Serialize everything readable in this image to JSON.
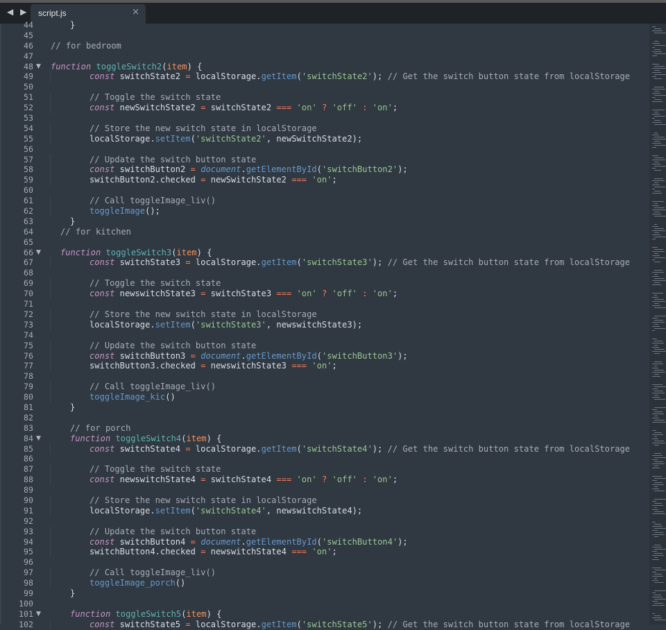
{
  "tab": {
    "filename": "script.js",
    "close_glyph": "×"
  },
  "nav": {
    "back": "◀",
    "forward": "▶"
  },
  "lines": [
    {
      "n": 44,
      "indent": 2,
      "parts": [
        [
          "}",
          ""
        ]
      ]
    },
    {
      "n": 45,
      "parts": []
    },
    {
      "n": 46,
      "indent": 0,
      "parts": [
        [
          "// for bedroom",
          "c"
        ]
      ]
    },
    {
      "n": 47,
      "parts": []
    },
    {
      "n": 48,
      "fold": true,
      "indent": 0,
      "parts": [
        [
          "function",
          "k"
        ],
        [
          " ",
          ""
        ],
        [
          "toggleSwitch2",
          "fn"
        ],
        [
          "(",
          ""
        ],
        [
          "item",
          "p"
        ],
        [
          ") {",
          ""
        ]
      ]
    },
    {
      "n": 49,
      "indent": 4,
      "parts": [
        [
          "const",
          "k"
        ],
        [
          " switchState2 ",
          ""
        ],
        [
          "=",
          "o"
        ],
        [
          " localStorage.",
          ""
        ],
        [
          "getItem",
          "f"
        ],
        [
          "(",
          ""
        ],
        [
          "'switchState2'",
          "s"
        ],
        [
          "); ",
          ""
        ],
        [
          "// Get the switch button state from localStorage",
          "c"
        ]
      ]
    },
    {
      "n": 50,
      "parts": []
    },
    {
      "n": 51,
      "indent": 4,
      "parts": [
        [
          "// Toggle the switch state",
          "c"
        ]
      ]
    },
    {
      "n": 52,
      "indent": 4,
      "parts": [
        [
          "const",
          "k"
        ],
        [
          " newSwitchState2 ",
          ""
        ],
        [
          "=",
          "o"
        ],
        [
          " switchState2 ",
          ""
        ],
        [
          "===",
          "o"
        ],
        [
          " ",
          ""
        ],
        [
          "'on'",
          "s"
        ],
        [
          " ",
          ""
        ],
        [
          "?",
          "o"
        ],
        [
          " ",
          ""
        ],
        [
          "'off'",
          "s"
        ],
        [
          " ",
          ""
        ],
        [
          ":",
          "o"
        ],
        [
          " ",
          ""
        ],
        [
          "'on'",
          "s"
        ],
        [
          ";",
          ""
        ]
      ]
    },
    {
      "n": 53,
      "parts": []
    },
    {
      "n": 54,
      "indent": 4,
      "parts": [
        [
          "// Store the new switch state in localStorage",
          "c"
        ]
      ]
    },
    {
      "n": 55,
      "indent": 4,
      "parts": [
        [
          "localStorage.",
          ""
        ],
        [
          "setItem",
          "f"
        ],
        [
          "(",
          ""
        ],
        [
          "'switchState2'",
          "s"
        ],
        [
          ", newSwitchState2);",
          ""
        ]
      ]
    },
    {
      "n": 56,
      "parts": []
    },
    {
      "n": 57,
      "indent": 4,
      "parts": [
        [
          "// Update the switch button state",
          "c"
        ]
      ]
    },
    {
      "n": 58,
      "indent": 4,
      "parts": [
        [
          "const",
          "k"
        ],
        [
          " switchButton2 ",
          ""
        ],
        [
          "=",
          "o"
        ],
        [
          " ",
          ""
        ],
        [
          "document",
          "k2"
        ],
        [
          ".",
          ""
        ],
        [
          "getElementById",
          "f"
        ],
        [
          "(",
          ""
        ],
        [
          "'switchButton2'",
          "s"
        ],
        [
          ");",
          ""
        ]
      ]
    },
    {
      "n": 59,
      "indent": 4,
      "parts": [
        [
          "switchButton2.checked ",
          ""
        ],
        [
          "=",
          "o"
        ],
        [
          " newSwitchState2 ",
          ""
        ],
        [
          "===",
          "o"
        ],
        [
          " ",
          ""
        ],
        [
          "'on'",
          "s"
        ],
        [
          ";",
          ""
        ]
      ]
    },
    {
      "n": 60,
      "parts": []
    },
    {
      "n": 61,
      "indent": 4,
      "parts": [
        [
          "// Call toggleImage_liv()",
          "c"
        ]
      ]
    },
    {
      "n": 62,
      "indent": 4,
      "parts": [
        [
          "toggleImage",
          "f"
        ],
        [
          "();",
          ""
        ]
      ]
    },
    {
      "n": 63,
      "indent": 2,
      "parts": [
        [
          "}",
          ""
        ]
      ]
    },
    {
      "n": 64,
      "indent": 1,
      "parts": [
        [
          "// for kitchen",
          "c"
        ]
      ]
    },
    {
      "n": 65,
      "parts": []
    },
    {
      "n": 66,
      "fold": true,
      "indent": 1,
      "parts": [
        [
          "function",
          "k"
        ],
        [
          " ",
          ""
        ],
        [
          "toggleSwitch3",
          "fn"
        ],
        [
          "(",
          ""
        ],
        [
          "item",
          "p"
        ],
        [
          ") {",
          ""
        ]
      ]
    },
    {
      "n": 67,
      "indent": 4,
      "parts": [
        [
          "const",
          "k"
        ],
        [
          " switchState3 ",
          ""
        ],
        [
          "=",
          "o"
        ],
        [
          " localStorage.",
          ""
        ],
        [
          "getItem",
          "f"
        ],
        [
          "(",
          ""
        ],
        [
          "'switchState3'",
          "s"
        ],
        [
          "); ",
          ""
        ],
        [
          "// Get the switch button state from localStorage",
          "c"
        ]
      ]
    },
    {
      "n": 68,
      "parts": []
    },
    {
      "n": 69,
      "indent": 4,
      "parts": [
        [
          "// Toggle the switch state",
          "c"
        ]
      ]
    },
    {
      "n": 70,
      "indent": 4,
      "parts": [
        [
          "const",
          "k"
        ],
        [
          " newswitchState3 ",
          ""
        ],
        [
          "=",
          "o"
        ],
        [
          " switchState3 ",
          ""
        ],
        [
          "===",
          "o"
        ],
        [
          " ",
          ""
        ],
        [
          "'on'",
          "s"
        ],
        [
          " ",
          ""
        ],
        [
          "?",
          "o"
        ],
        [
          " ",
          ""
        ],
        [
          "'off'",
          "s"
        ],
        [
          " ",
          ""
        ],
        [
          ":",
          "o"
        ],
        [
          " ",
          ""
        ],
        [
          "'on'",
          "s"
        ],
        [
          ";",
          ""
        ]
      ]
    },
    {
      "n": 71,
      "parts": []
    },
    {
      "n": 72,
      "indent": 4,
      "parts": [
        [
          "// Store the new switch state in localStorage",
          "c"
        ]
      ]
    },
    {
      "n": 73,
      "indent": 4,
      "parts": [
        [
          "localStorage.",
          ""
        ],
        [
          "setItem",
          "f"
        ],
        [
          "(",
          ""
        ],
        [
          "'switchState3'",
          "s"
        ],
        [
          ", newswitchState3);",
          ""
        ]
      ]
    },
    {
      "n": 74,
      "parts": []
    },
    {
      "n": 75,
      "indent": 4,
      "parts": [
        [
          "// Update the switch button state",
          "c"
        ]
      ]
    },
    {
      "n": 76,
      "indent": 4,
      "parts": [
        [
          "const",
          "k"
        ],
        [
          " switchButton3 ",
          ""
        ],
        [
          "=",
          "o"
        ],
        [
          " ",
          ""
        ],
        [
          "document",
          "k2"
        ],
        [
          ".",
          ""
        ],
        [
          "getElementById",
          "f"
        ],
        [
          "(",
          ""
        ],
        [
          "'switchButton3'",
          "s"
        ],
        [
          ");",
          ""
        ]
      ]
    },
    {
      "n": 77,
      "indent": 4,
      "parts": [
        [
          "switchButton3.checked ",
          ""
        ],
        [
          "=",
          "o"
        ],
        [
          " newswitchState3 ",
          ""
        ],
        [
          "===",
          "o"
        ],
        [
          " ",
          ""
        ],
        [
          "'on'",
          "s"
        ],
        [
          ";",
          ""
        ]
      ]
    },
    {
      "n": 78,
      "parts": []
    },
    {
      "n": 79,
      "indent": 4,
      "parts": [
        [
          "// Call toggleImage_liv()",
          "c"
        ]
      ]
    },
    {
      "n": 80,
      "indent": 4,
      "parts": [
        [
          "toggleImage_kic",
          "f"
        ],
        [
          "()",
          ""
        ]
      ]
    },
    {
      "n": 81,
      "indent": 2,
      "parts": [
        [
          "}",
          ""
        ]
      ]
    },
    {
      "n": 82,
      "parts": []
    },
    {
      "n": 83,
      "indent": 2,
      "parts": [
        [
          "// for porch",
          "c"
        ]
      ]
    },
    {
      "n": 84,
      "fold": true,
      "indent": 2,
      "parts": [
        [
          "function",
          "k"
        ],
        [
          " ",
          ""
        ],
        [
          "toggleSwitch4",
          "fn"
        ],
        [
          "(",
          ""
        ],
        [
          "item",
          "p"
        ],
        [
          ") {",
          ""
        ]
      ]
    },
    {
      "n": 85,
      "indent": 4,
      "parts": [
        [
          "const",
          "k"
        ],
        [
          " switchState4 ",
          ""
        ],
        [
          "=",
          "o"
        ],
        [
          " localStorage.",
          ""
        ],
        [
          "getItem",
          "f"
        ],
        [
          "(",
          ""
        ],
        [
          "'switchState4'",
          "s"
        ],
        [
          "); ",
          ""
        ],
        [
          "// Get the switch button state from localStorage",
          "c"
        ]
      ]
    },
    {
      "n": 86,
      "parts": []
    },
    {
      "n": 87,
      "indent": 4,
      "parts": [
        [
          "// Toggle the switch state",
          "c"
        ]
      ]
    },
    {
      "n": 88,
      "indent": 4,
      "parts": [
        [
          "const",
          "k"
        ],
        [
          " newswitchState4 ",
          ""
        ],
        [
          "=",
          "o"
        ],
        [
          " switchState4 ",
          ""
        ],
        [
          "===",
          "o"
        ],
        [
          " ",
          ""
        ],
        [
          "'on'",
          "s"
        ],
        [
          " ",
          ""
        ],
        [
          "?",
          "o"
        ],
        [
          " ",
          ""
        ],
        [
          "'off'",
          "s"
        ],
        [
          " ",
          ""
        ],
        [
          ":",
          "o"
        ],
        [
          " ",
          ""
        ],
        [
          "'on'",
          "s"
        ],
        [
          ";",
          ""
        ]
      ]
    },
    {
      "n": 89,
      "parts": []
    },
    {
      "n": 90,
      "indent": 4,
      "parts": [
        [
          "// Store the new switch state in localStorage",
          "c"
        ]
      ]
    },
    {
      "n": 91,
      "indent": 4,
      "parts": [
        [
          "localStorage.",
          ""
        ],
        [
          "setItem",
          "f"
        ],
        [
          "(",
          ""
        ],
        [
          "'switchState4'",
          "s"
        ],
        [
          ", newswitchState4);",
          ""
        ]
      ]
    },
    {
      "n": 92,
      "parts": []
    },
    {
      "n": 93,
      "indent": 4,
      "parts": [
        [
          "// Update the switch button state",
          "c"
        ]
      ]
    },
    {
      "n": 94,
      "indent": 4,
      "parts": [
        [
          "const",
          "k"
        ],
        [
          " switchButton4 ",
          ""
        ],
        [
          "=",
          "o"
        ],
        [
          " ",
          ""
        ],
        [
          "document",
          "k2"
        ],
        [
          ".",
          ""
        ],
        [
          "getElementById",
          "f"
        ],
        [
          "(",
          ""
        ],
        [
          "'switchButton4'",
          "s"
        ],
        [
          ");",
          ""
        ]
      ]
    },
    {
      "n": 95,
      "indent": 4,
      "parts": [
        [
          "switchButton4.checked ",
          ""
        ],
        [
          "=",
          "o"
        ],
        [
          " newswitchState4 ",
          ""
        ],
        [
          "===",
          "o"
        ],
        [
          " ",
          ""
        ],
        [
          "'on'",
          "s"
        ],
        [
          ";",
          ""
        ]
      ]
    },
    {
      "n": 96,
      "parts": []
    },
    {
      "n": 97,
      "indent": 4,
      "parts": [
        [
          "// Call toggleImage_liv()",
          "c"
        ]
      ]
    },
    {
      "n": 98,
      "indent": 4,
      "parts": [
        [
          "toggleImage_porch",
          "f"
        ],
        [
          "()",
          ""
        ]
      ]
    },
    {
      "n": 99,
      "indent": 2,
      "parts": [
        [
          "}",
          ""
        ]
      ]
    },
    {
      "n": 100,
      "parts": []
    },
    {
      "n": 101,
      "fold": true,
      "indent": 2,
      "parts": [
        [
          "function",
          "k"
        ],
        [
          " ",
          ""
        ],
        [
          "toggleSwitch5",
          "fn"
        ],
        [
          "(",
          ""
        ],
        [
          "item",
          "p"
        ],
        [
          ") {",
          ""
        ]
      ]
    },
    {
      "n": 102,
      "indent": 4,
      "parts": [
        [
          "const",
          "k"
        ],
        [
          " switchState5 ",
          ""
        ],
        [
          "=",
          "o"
        ],
        [
          " localStorage.",
          ""
        ],
        [
          "getItem",
          "f"
        ],
        [
          "(",
          ""
        ],
        [
          "'switchState5'",
          "s"
        ],
        [
          "); ",
          ""
        ],
        [
          "// Get the switch button state from localStorage",
          "c"
        ]
      ]
    }
  ]
}
